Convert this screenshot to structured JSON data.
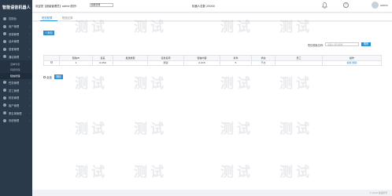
{
  "app": {
    "brand": "智能语音机器人"
  },
  "sidebar": {
    "items": [
      {
        "label": "控制台"
      },
      {
        "label": "用户管理"
      },
      {
        "label": "资源管理"
      },
      {
        "label": "话术管理"
      },
      {
        "label": "语音管理"
      },
      {
        "label": "通话管理"
      },
      {
        "sub": "话单列表"
      },
      {
        "sub": "转接管理"
      },
      {
        "sub": "短信管理",
        "active": true
      },
      {
        "label": "任务管理"
      },
      {
        "label": "员工管理"
      },
      {
        "label": "财务管理"
      },
      {
        "label": "客户管理"
      },
      {
        "label": "黑名单管理"
      },
      {
        "label": "系统管理"
      }
    ]
  },
  "topbar": {
    "account_text": "欢迎您【超级管理员】admin您好!",
    "select_value": "超级管理",
    "center_text": "机器人总数 25000",
    "user_name": "admin"
  },
  "tabs": [
    {
      "label": "短信配置"
    },
    {
      "label": "短信记录"
    }
  ],
  "toolbar": {
    "add_label": "+添加"
  },
  "search": {
    "label": "短信模板名称:",
    "placeholder": "请输入短信模板",
    "button_label": "搜索"
  },
  "table": {
    "headers": [
      "",
      "短信ID",
      "签名",
      "发送类型",
      "任务名称",
      "短信内容",
      "条件",
      "状态",
      "员工",
      "操作"
    ],
    "rows": [
      {
        "cells": [
          "",
          "1",
          "0.050",
          "",
          "测试",
          "0.015",
          "5",
          "开启",
          "",
          ""
        ],
        "actions": [
          "编辑",
          "删除"
        ]
      }
    ]
  },
  "bulk": {
    "select_all_label": "全选",
    "delete_label": "删除"
  },
  "footer": {
    "text": "© 2019 版权所有"
  },
  "watermark": "测试"
}
